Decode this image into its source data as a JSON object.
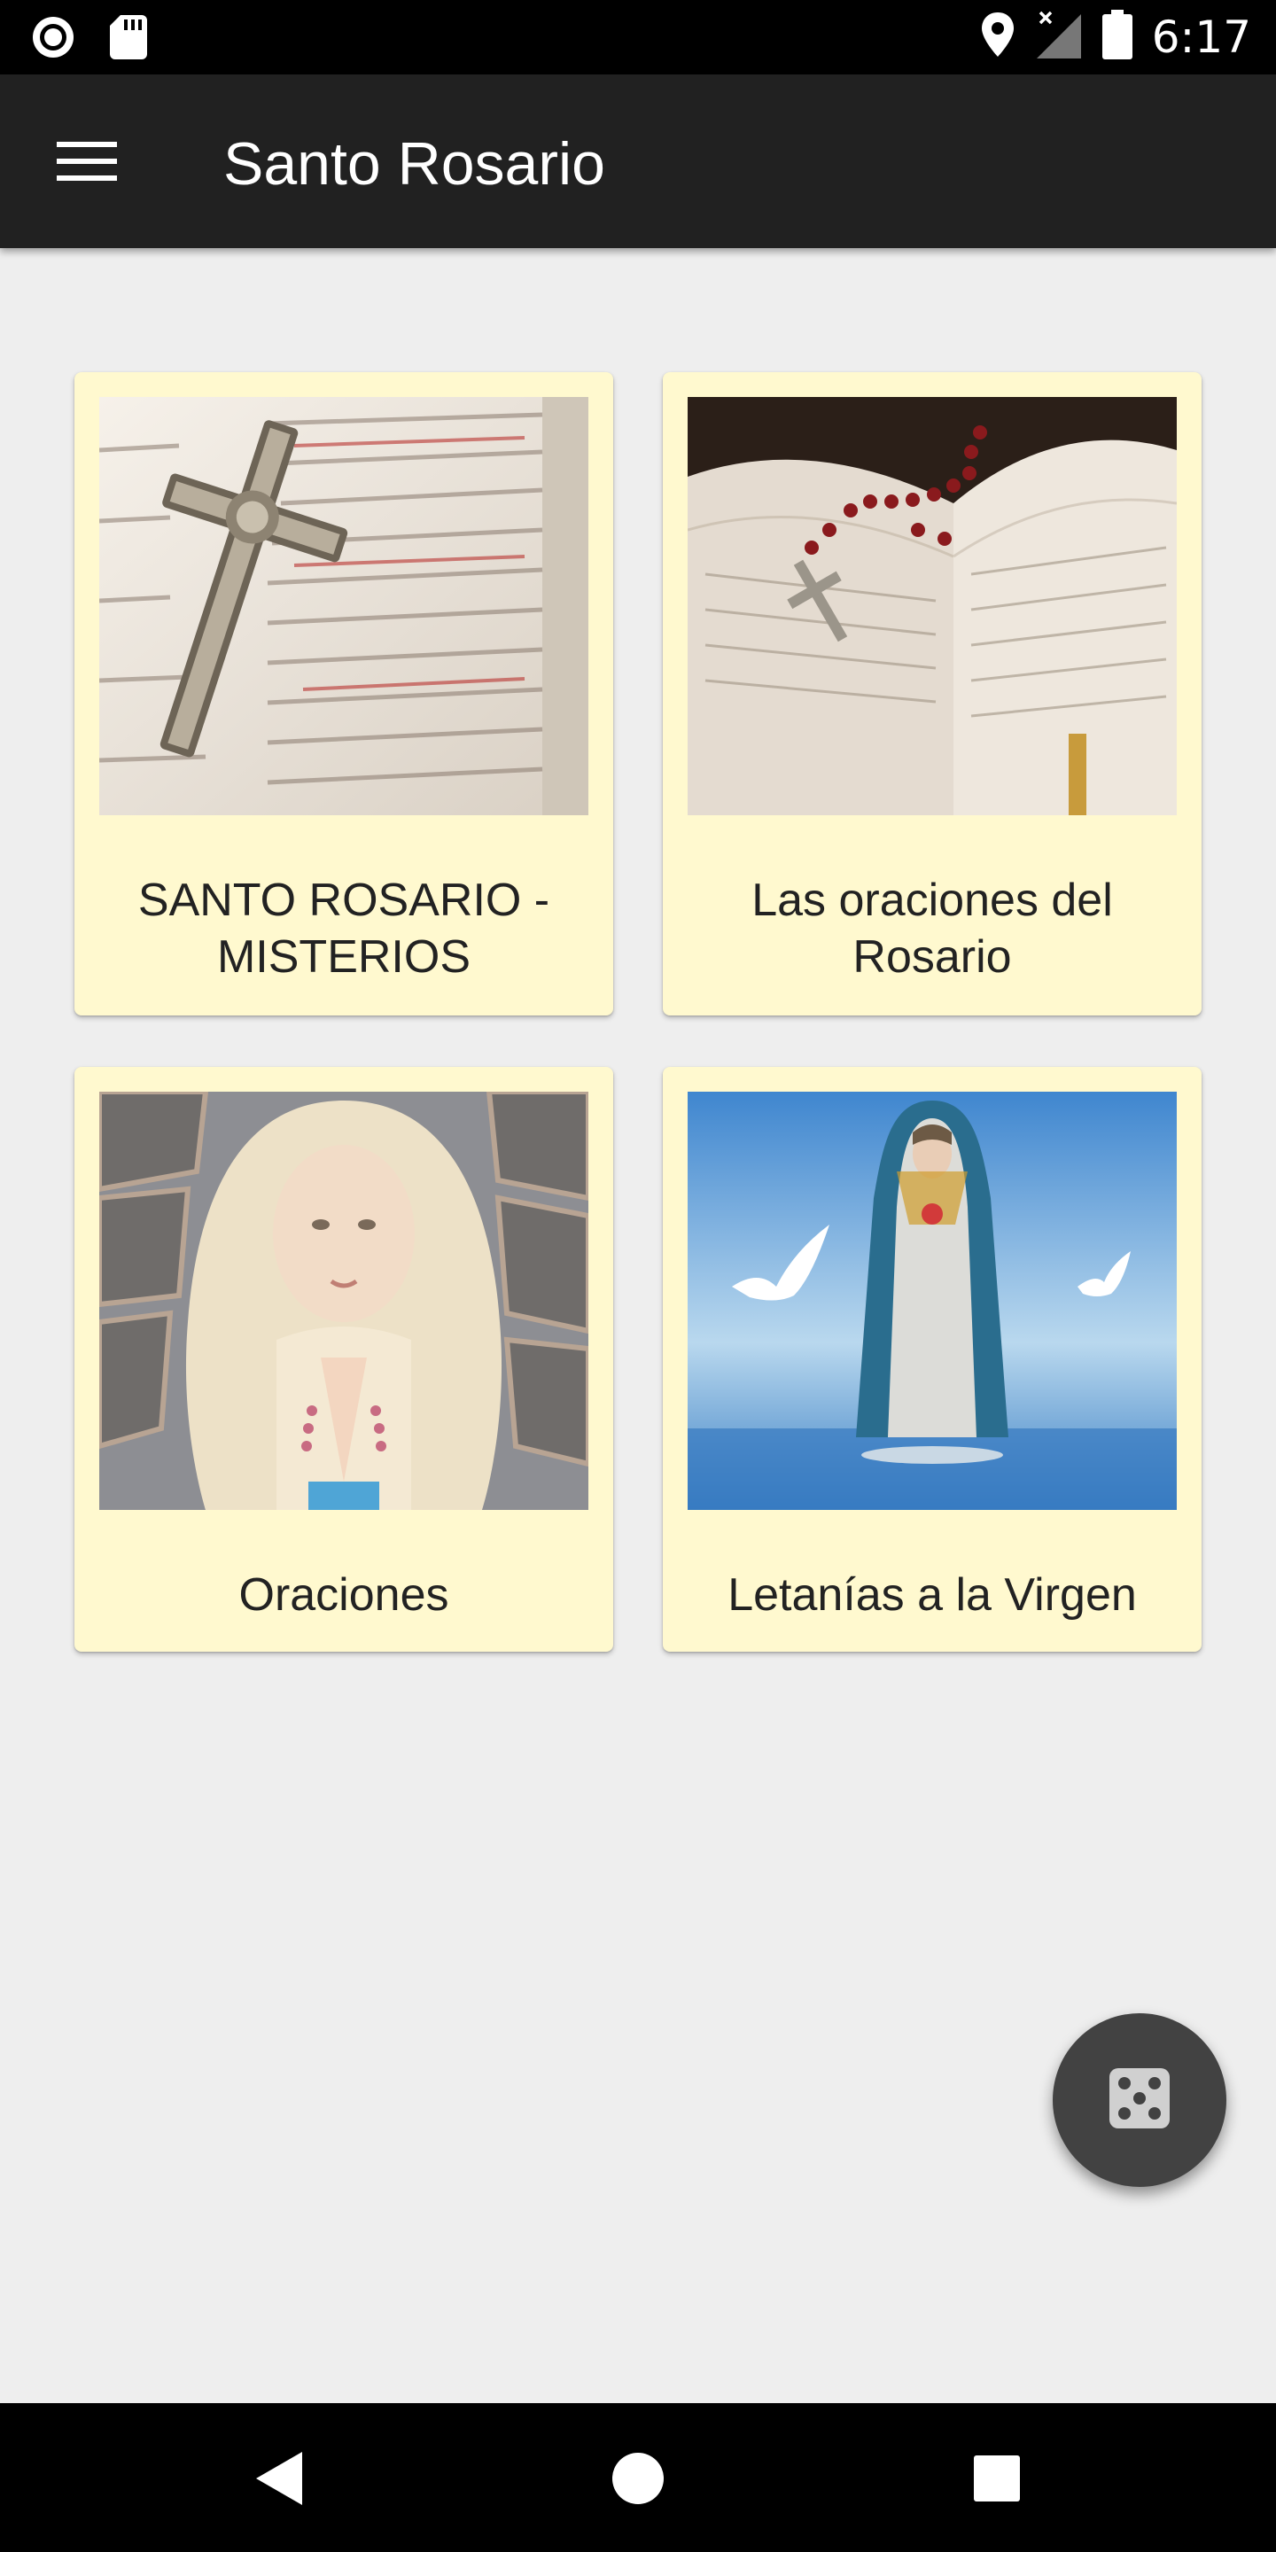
{
  "status_bar": {
    "time": "6:17",
    "icons": [
      "record-icon",
      "sd-card-icon",
      "location-icon",
      "no-signal-icon",
      "battery-icon"
    ]
  },
  "app_bar": {
    "title": "Santo Rosario",
    "menu_icon": "hamburger-menu-icon"
  },
  "cards": [
    {
      "label": "SANTO ROSARIO - MISTERIOS",
      "image": "crucifix-on-bible"
    },
    {
      "label": "Las oraciones del Rosario",
      "image": "rosary-on-open-book"
    },
    {
      "label": "Oraciones",
      "image": "virgin-statue-praying"
    },
    {
      "label": "Letanías a la Virgen",
      "image": "virgin-on-water-with-doves"
    }
  ],
  "fab": {
    "icon": "dice-icon"
  },
  "nav_bar": {
    "icons": [
      "back-icon",
      "home-icon",
      "recents-icon"
    ]
  },
  "colors": {
    "app_bar": "#212121",
    "card_background": "#fff9cf",
    "page_background": "#eeeeee",
    "fab": "#424242"
  }
}
